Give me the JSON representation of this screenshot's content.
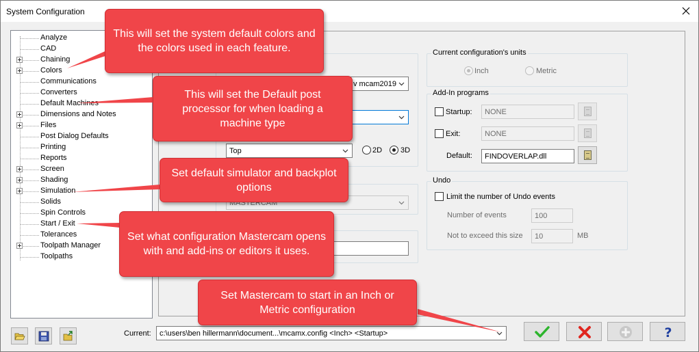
{
  "window": {
    "title": "System Configuration"
  },
  "tree": {
    "items": [
      {
        "label": "Analyze",
        "expandable": false
      },
      {
        "label": "CAD",
        "expandable": false
      },
      {
        "label": "Chaining",
        "expandable": true
      },
      {
        "label": "Colors",
        "expandable": true
      },
      {
        "label": "Communications",
        "expandable": false
      },
      {
        "label": "Converters",
        "expandable": false
      },
      {
        "label": "Default Machines",
        "expandable": false
      },
      {
        "label": "Dimensions and Notes",
        "expandable": true
      },
      {
        "label": "Files",
        "expandable": true
      },
      {
        "label": "Post Dialog Defaults",
        "expandable": false
      },
      {
        "label": "Printing",
        "expandable": false
      },
      {
        "label": "Reports",
        "expandable": false
      },
      {
        "label": "Screen",
        "expandable": true
      },
      {
        "label": "Shading",
        "expandable": true
      },
      {
        "label": "Simulation",
        "expandable": true
      },
      {
        "label": "Solids",
        "expandable": false
      },
      {
        "label": "Spin Controls",
        "expandable": false
      },
      {
        "label": "Start / Exit",
        "expandable": false
      },
      {
        "label": "Tolerances",
        "expandable": false
      },
      {
        "label": "Toolpath Manager",
        "expandable": true
      },
      {
        "label": "Toolpaths",
        "expandable": false
      }
    ]
  },
  "left": {
    "config_combo": "v mcam2019",
    "view_combo": "Top",
    "radio_2d": "2D",
    "radio_3d": "3D",
    "editor_combo": "MASTERCAM"
  },
  "units": {
    "title": "Current configuration's units",
    "inch": "Inch",
    "metric": "Metric",
    "selected": "Inch"
  },
  "addins": {
    "title": "Add-In programs",
    "startup_label": "Startup:",
    "startup_value": "NONE",
    "exit_label": "Exit:",
    "exit_value": "NONE",
    "default_label": "Default:",
    "default_value": "FINDOVERLAP.dll"
  },
  "undo": {
    "title": "Undo",
    "limit_label": "Limit the number of Undo events",
    "events_label": "Number of events",
    "events_value": "100",
    "size_label": "Not to exceed this size",
    "size_value": "10",
    "size_unit": "MB"
  },
  "footer": {
    "current_label": "Current:",
    "current_value": "c:\\users\\ben hillermann\\document...\\mcamx.config <Inch> <Startup>"
  },
  "callouts": {
    "colors": "This will set the system default colors and the colors used in each feature.",
    "machines": "This will set the Default post processor for when loading a machine type",
    "simulation": "Set default simulator and backplot options",
    "startexit": "Set what configuration Mastercam opens with and add-ins or editors it uses.",
    "units": "Set Mastercam to start in an Inch or Metric configuration"
  },
  "colors": {
    "callout_bg": "#f04549",
    "ok_green": "#2db52d",
    "cancel_red": "#e0261f"
  }
}
